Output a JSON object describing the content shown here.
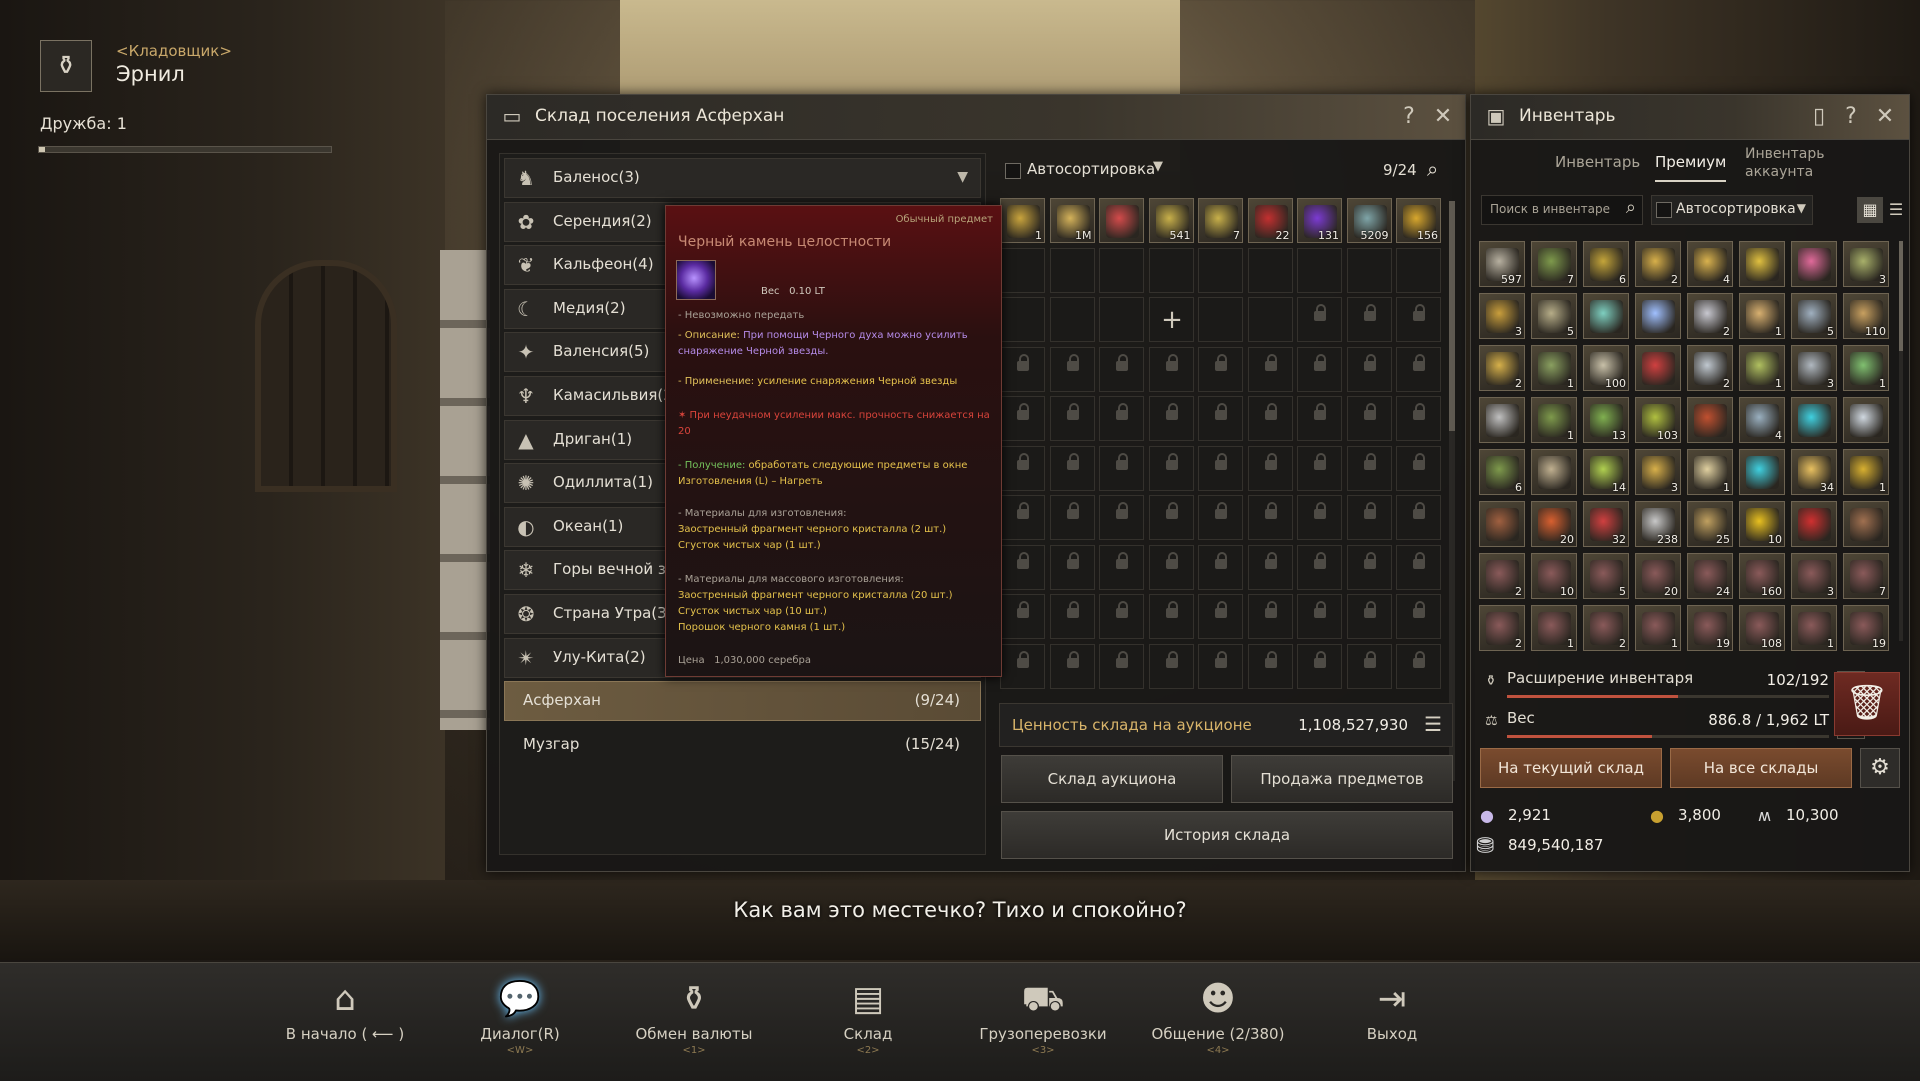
{
  "npc": {
    "role": "<Кладовщик>",
    "name": "Эрнил",
    "friendship_label": "Дружба: 1",
    "friendship_progress": 0.02
  },
  "warehouse": {
    "title": "Склад поселения Асферхан",
    "help": "?",
    "close": "✕",
    "regions": [
      {
        "label": "Баленос(3)",
        "icon": "♞",
        "icon_name": "horse-icon"
      },
      {
        "label": "Серендия(2)",
        "icon": "✿",
        "icon_name": "flower-icon"
      },
      {
        "label": "Кальфеон(4)",
        "icon": "❦",
        "icon_name": "crest-icon"
      },
      {
        "label": "Медия(2)",
        "icon": "☾",
        "icon_name": "moon-icon"
      },
      {
        "label": "Валенсия(5)",
        "icon": "✦",
        "icon_name": "star-icon"
      },
      {
        "label": "Камасильвия(2)",
        "icon": "♆",
        "icon_name": "tree-icon"
      },
      {
        "label": "Дриган(1)",
        "icon": "▲",
        "icon_name": "mountain-icon"
      },
      {
        "label": "Одиллита(1)",
        "icon": "✺",
        "icon_name": "sun-icon"
      },
      {
        "label": "Океан(1)",
        "icon": "◐",
        "icon_name": "ocean-icon"
      },
      {
        "label": "Горы вечной зимы(1)",
        "icon": "❄",
        "icon_name": "snow-icon"
      },
      {
        "label": "Страна Утра(3)",
        "icon": "❂",
        "icon_name": "morning-icon"
      },
      {
        "label": "Улу-Кита(2)",
        "icon": "✴",
        "icon_name": "ulukita-icon"
      }
    ],
    "selected_town": {
      "label": "Асферхан",
      "count": "(9/24)"
    },
    "other_town": {
      "label": "Музгар",
      "count": "(15/24)"
    },
    "autosort_label": "Автосортировка",
    "capacity": "9/24",
    "items": [
      {
        "count": "1",
        "color": "#c9a43d"
      },
      {
        "count": "1M",
        "color": "#d4b25a"
      },
      {
        "count": "",
        "color": "#d34b4b"
      },
      {
        "count": "541",
        "color": "#c8b04a"
      },
      {
        "count": "7",
        "color": "#c8b04a"
      },
      {
        "count": "22",
        "color": "#c23030"
      },
      {
        "count": "131",
        "color": "#7c3bd3"
      },
      {
        "count": "5209",
        "color": "#7fa5a8"
      },
      {
        "count": "156",
        "color": "#d8a72d"
      }
    ],
    "auction_value_label": "Ценность склада на аукционе",
    "auction_value": "1,108,527,930",
    "btn_auction": "Склад аукциона",
    "btn_sell": "Продажа предметов",
    "btn_history": "История склада",
    "add_slot": "+"
  },
  "tooltip": {
    "grade": "Обычный предмет",
    "name": "Черный камень целостности",
    "weight_label": "Вес",
    "weight": "0.10 LT",
    "no_transfer": "- Невозможно передать",
    "desc_label": "- Описание:",
    "desc": "При помощи Черного духа можно усилить снаряжение Черной звезды.",
    "use_label": "- Применение:",
    "use": "усиление снаряжения Черной звезды",
    "fail": "✶ При неудачном усилении макс. прочность снижается на 20",
    "obtain_label": "- Получение:",
    "obtain": "обработать следующие предметы в окне Изготовления (L) – Нагреть",
    "mats_label": "- Материалы для изготовления:",
    "mats": [
      "Заостренный фрагмент черного кристалла (2 шт.)",
      "Сгусток чистых чар (1 шт.)"
    ],
    "mass_label": "- Материалы для массового изготовления:",
    "mass": [
      "Заостренный фрагмент черного кристалла (20 шт.)",
      "Сгусток чистых чар (10 шт.)",
      "Порошок черного камня (1 шт.)"
    ],
    "price_label": "Цена",
    "price": "1,030,000 серебра"
  },
  "inventory": {
    "title": "Инвентарь",
    "tabs": [
      "Инвентарь",
      "Премиум",
      "Инвентарь аккаунта"
    ],
    "active_tab": 1,
    "search_placeholder": "Поиск в инвентаре",
    "autosort_label": "Автосортировка",
    "items": [
      "597",
      "7",
      "6",
      "2",
      "4",
      "",
      "",
      "3",
      "3",
      "5",
      "",
      "",
      "2",
      "1",
      "5",
      "110",
      "2",
      "1",
      "100",
      "",
      "2",
      "1",
      "3",
      "1",
      "",
      "1",
      "13",
      "103",
      "",
      "4",
      "",
      "",
      "6",
      "",
      "14",
      "3",
      "1",
      "",
      "34",
      "1",
      "",
      "20",
      "32",
      "238",
      "25",
      "10",
      "",
      "",
      "2",
      "10",
      "5",
      "20",
      "24",
      "160",
      "3",
      "7",
      "2",
      "1",
      "2",
      "1",
      "19",
      "108",
      "1",
      "19"
    ],
    "colors": [
      "#b7b0a0",
      "#7e9a4c",
      "#c4a53a",
      "#d8b04a",
      "#d9b24e",
      "#e0c040",
      "#e06a9a",
      "#a8b06a",
      "#c99e3c",
      "#b6ad88",
      "#7ecfc0",
      "#a0c0ff",
      "#c8c8d0",
      "#d8b070",
      "#a0b0c0",
      "#c8a060",
      "#d6b04a",
      "#8aa060",
      "#c8c0a8",
      "#d04040",
      "#c0c8d0",
      "#b0c060",
      "#b0b8c0",
      "#80c070",
      "#c0c0c0",
      "#7e9a4c",
      "#80b050",
      "#b0c040",
      "#c05030",
      "#9ab0c0",
      "#40d0e0",
      "#d0d8e0",
      "#7e9a4c",
      "#c0b090",
      "#b0d050",
      "#d8b04a",
      "#e0d0a0",
      "#40d0e0",
      "#e8c060",
      "#d8b030",
      "#a06040",
      "#d86030",
      "#d04040",
      "#c8c8c8",
      "#c0a060",
      "#e8c020",
      "#d03030",
      "#a07050",
      "#8a5a5a",
      "#8a5a5a",
      "#8a5a5a",
      "#8a5a5a",
      "#8a5a5a",
      "#8a5a5a",
      "#8a5a5a",
      "#8a5a5a",
      "#8a5a5a",
      "#8a5a5a",
      "#8a5a5a",
      "#8a5a5a",
      "#8a5a5a",
      "#8a5a5a",
      "#8a5a5a",
      "#8a5a5a"
    ],
    "expand_label": "Расширение инвентаря",
    "expand_value": "102/192",
    "expand_progress": 0.53,
    "weight_label": "Вес",
    "weight_value": "886.8 / 1,962 LT",
    "weight_progress": 0.45,
    "btn_current": "На текущий склад",
    "btn_all": "На все склады",
    "currency": [
      {
        "icon": "●",
        "name": "pearl-icon",
        "value": "2,921",
        "color": "#c8b8e8"
      },
      {
        "icon": "●",
        "name": "gold-coin-icon",
        "value": "3,800",
        "color": "#c8a030"
      },
      {
        "icon": "ʍ",
        "name": "energy-icon",
        "value": "10,300",
        "color": "#d8d8d8"
      }
    ],
    "silver": "849,540,187"
  },
  "dialogue": "Как вам это местечко? Тихо и спокойно?",
  "actions": [
    {
      "label": "В начало ( ⟵ )",
      "key": "",
      "icon": "⌂",
      "name": "home-action-button"
    },
    {
      "label": "Диалог(R)",
      "key": "<W>",
      "icon": "💬",
      "name": "dialog-action-button",
      "active": true
    },
    {
      "label": "Обмен валюты",
      "key": "<1>",
      "icon": "⚱",
      "name": "exchange-action-button"
    },
    {
      "label": "Склад",
      "key": "<2>",
      "icon": "▤",
      "name": "storage-action-button"
    },
    {
      "label": "Грузоперевозки",
      "key": "<3>",
      "icon": "⛟",
      "name": "transport-action-button"
    },
    {
      "label": "Общение (2/380)",
      "key": "<4>",
      "icon": "☻",
      "name": "social-action-button"
    },
    {
      "label": "Выход",
      "key": "",
      "icon": "⇥",
      "name": "exit-action-button"
    }
  ]
}
